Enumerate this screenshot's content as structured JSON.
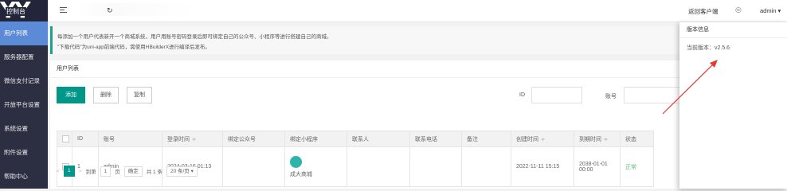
{
  "logo": {
    "mark": "YY",
    "text": "控制台"
  },
  "sidebar": {
    "items": [
      {
        "label": "用户列表",
        "active": true
      },
      {
        "label": "服务器配置"
      },
      {
        "label": "微信支付记录"
      },
      {
        "label": "开放平台设置"
      },
      {
        "label": "系统设置"
      },
      {
        "label": "附件设置"
      },
      {
        "label": "帮助中心"
      }
    ]
  },
  "topbar": {
    "refresh": "↻",
    "back_to_client": "返回客户端",
    "theme_icon": "◎",
    "user": "admin",
    "user_caret": "▾"
  },
  "notice": {
    "line1": "每添加一个用户代表新开一个商城系统，用户用账号密码登录后即可绑定自己的公众号、小程序等进行搭建自己的商城。",
    "line2": "\"下载代码\"为uni-app前端代码，需使用HBuilderX进行编译后发布。"
  },
  "card": {
    "title": "用户列表"
  },
  "toolbar": {
    "add": "添加",
    "delete": "删除",
    "copy": "复制",
    "id_label": "ID",
    "account_label": "账号"
  },
  "table": {
    "headers": [
      "ID",
      "账号",
      "登录时间",
      "绑定公众号",
      "绑定小程序",
      "联系人",
      "联系电话",
      "备注",
      "创建时间",
      "到期时间",
      "状态"
    ],
    "sort_mark": "≑",
    "rows": [
      {
        "id": "1",
        "account": "admin",
        "login_time": "2024-03-16 01:13",
        "mp": "",
        "mini_name": "成大商城",
        "contact": "",
        "phone": "",
        "remark": "",
        "created": "2022-11-11 15:15",
        "expires": "2038-01-01 00:00",
        "status": "正常"
      }
    ]
  },
  "pager": {
    "prev": "<",
    "current": "1",
    "next": ">",
    "goto": "到第",
    "page_input": "1",
    "page_unit": "页",
    "confirm": "确定",
    "total": "共 1 条",
    "size": "20 条/页 ▾"
  },
  "popup": {
    "title": "版本信息",
    "version_label": "当前版本：",
    "version": "v2.5.6"
  },
  "colors": {
    "sidebar": "#2c2e42",
    "active": "#5b8bd6",
    "primary": "#009688",
    "arrow": "#e53935"
  }
}
